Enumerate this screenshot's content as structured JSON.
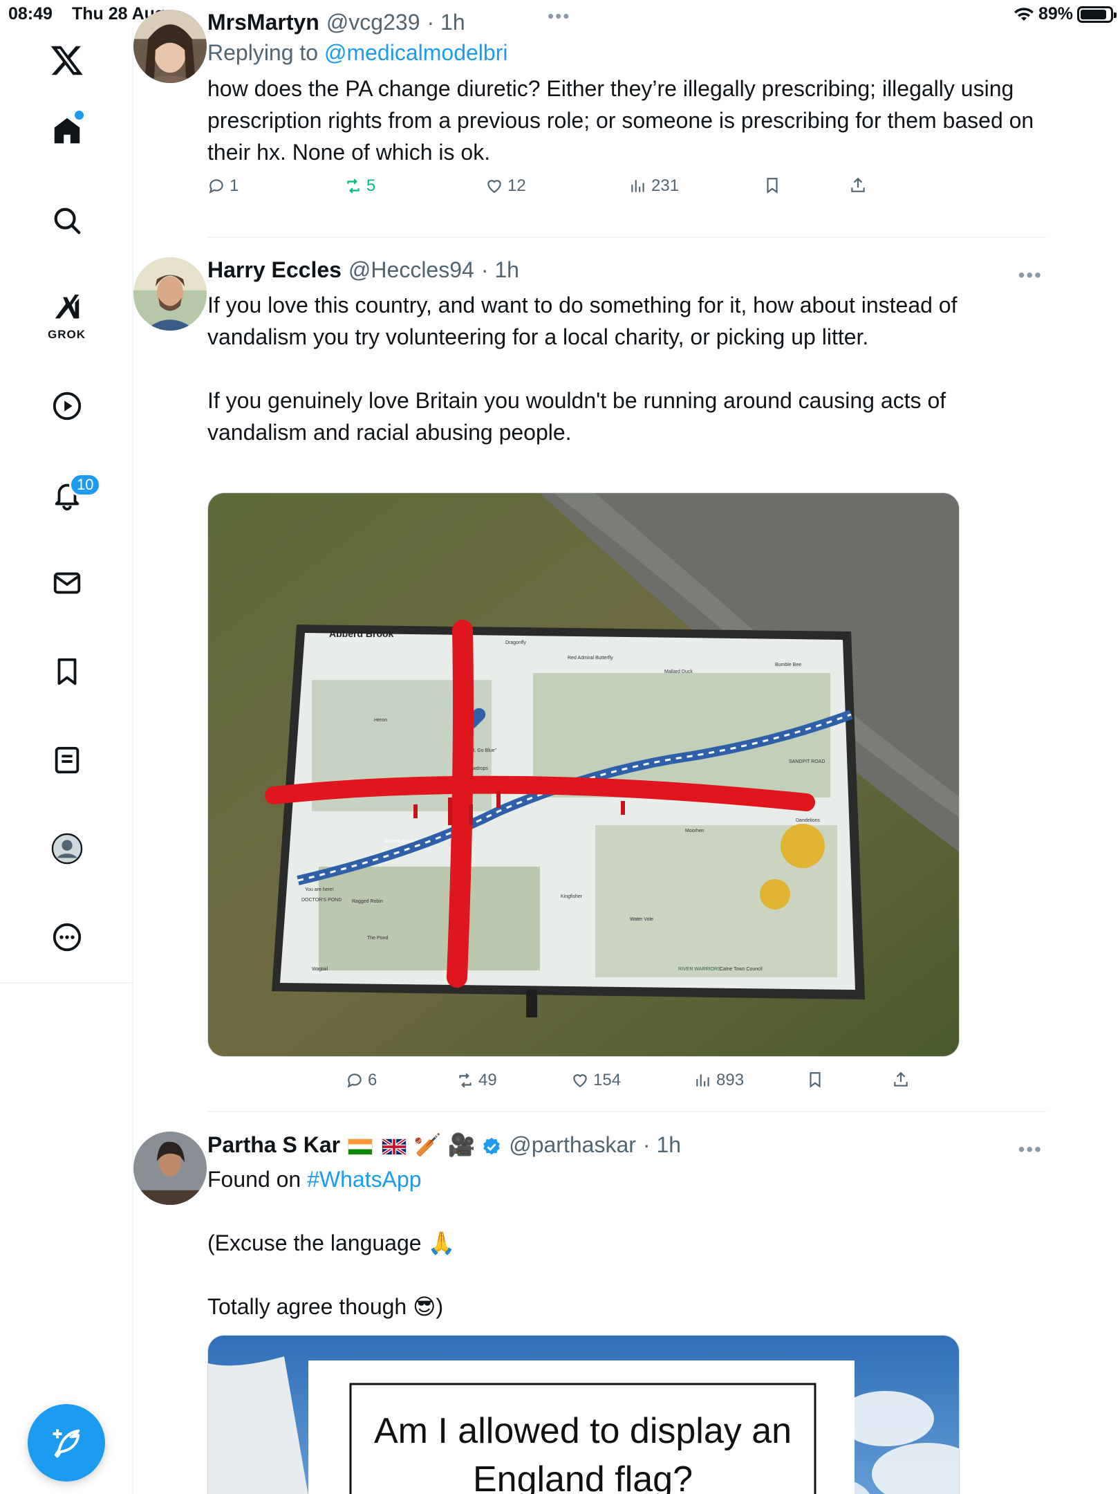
{
  "status": {
    "time": "08:49",
    "date": "Thu 28 Aug",
    "battery": "89%",
    "battery_level": 0.89
  },
  "sidebar": {
    "logo": "x-logo",
    "items": [
      {
        "name": "home",
        "icon": "home-icon"
      },
      {
        "name": "search",
        "icon": "search-icon"
      },
      {
        "name": "grok",
        "icon": "grok-icon",
        "label": "GROK"
      },
      {
        "name": "videos",
        "icon": "play-icon"
      },
      {
        "name": "notifications",
        "icon": "bell-icon",
        "badge": "10"
      },
      {
        "name": "messages",
        "icon": "mail-icon"
      },
      {
        "name": "bookmarks",
        "icon": "bookmark-icon"
      },
      {
        "name": "lists",
        "icon": "list-icon"
      },
      {
        "name": "profile",
        "icon": "avatar"
      },
      {
        "name": "more",
        "icon": "more-circle-icon"
      }
    ],
    "compose_icon": "compose-icon"
  },
  "tweets": [
    {
      "name": "MrsMartyn",
      "handle": "@vcg239",
      "time": "· 1h",
      "replying_prefix": "Replying to ",
      "replying_to": "@medicalmodelbri",
      "text": "how does the PA change diuretic? Either they’re illegally prescribing; illegally using prescription rights from a previous role; or someone is prescribing for them based on their hx. None of which is ok.",
      "replies": "1",
      "reposts": "5",
      "likes": "12",
      "views": "231"
    },
    {
      "name": "Harry Eccles",
      "handle": "@Heccles94",
      "time": "· 1h",
      "text": "If you love this country, and want to do something for it, how about instead of vandalism you try volunteering for a local charity, or picking up litter.\n\nIf you genuinely love Britain you wouldn't be running around causing acts of vandalism and racial abusing people.",
      "replies": "6",
      "reposts": "49",
      "likes": "154",
      "views": "893",
      "image": {
        "board_title": "Abberd Brook",
        "labels": [
          "Heron",
          "Snowdrops",
          "Dragonfly",
          "Red Admiral Butterfly",
          "Mallard Duck",
          "Bumble Bee",
          "SANDPIT ROAD",
          "Dandelions",
          "Moorhen",
          "Kingfisher",
          "Water Vole",
          "Wagtail",
          "DOCTOR'S POND",
          "Ragged Robin",
          "\"Go Wild, Go Blue\"",
          "Abberd Brook",
          "The Pond",
          "RIVER WARRIORS",
          "Calne Town Council",
          "You are here!"
        ]
      }
    },
    {
      "name": "Partha S Kar",
      "name_emoji": "🏏 🎥",
      "handle": "@parthaskar",
      "time": "· 1h",
      "text_prefix": "Found on ",
      "hashtag": "#WhatsApp",
      "text_rest": "\n\n(Excuse the language 🙏\n\nTotally agree though 😎)",
      "image": {
        "sign_line1": "Am I allowed to display an",
        "sign_line2": "England flag?"
      }
    }
  ]
}
